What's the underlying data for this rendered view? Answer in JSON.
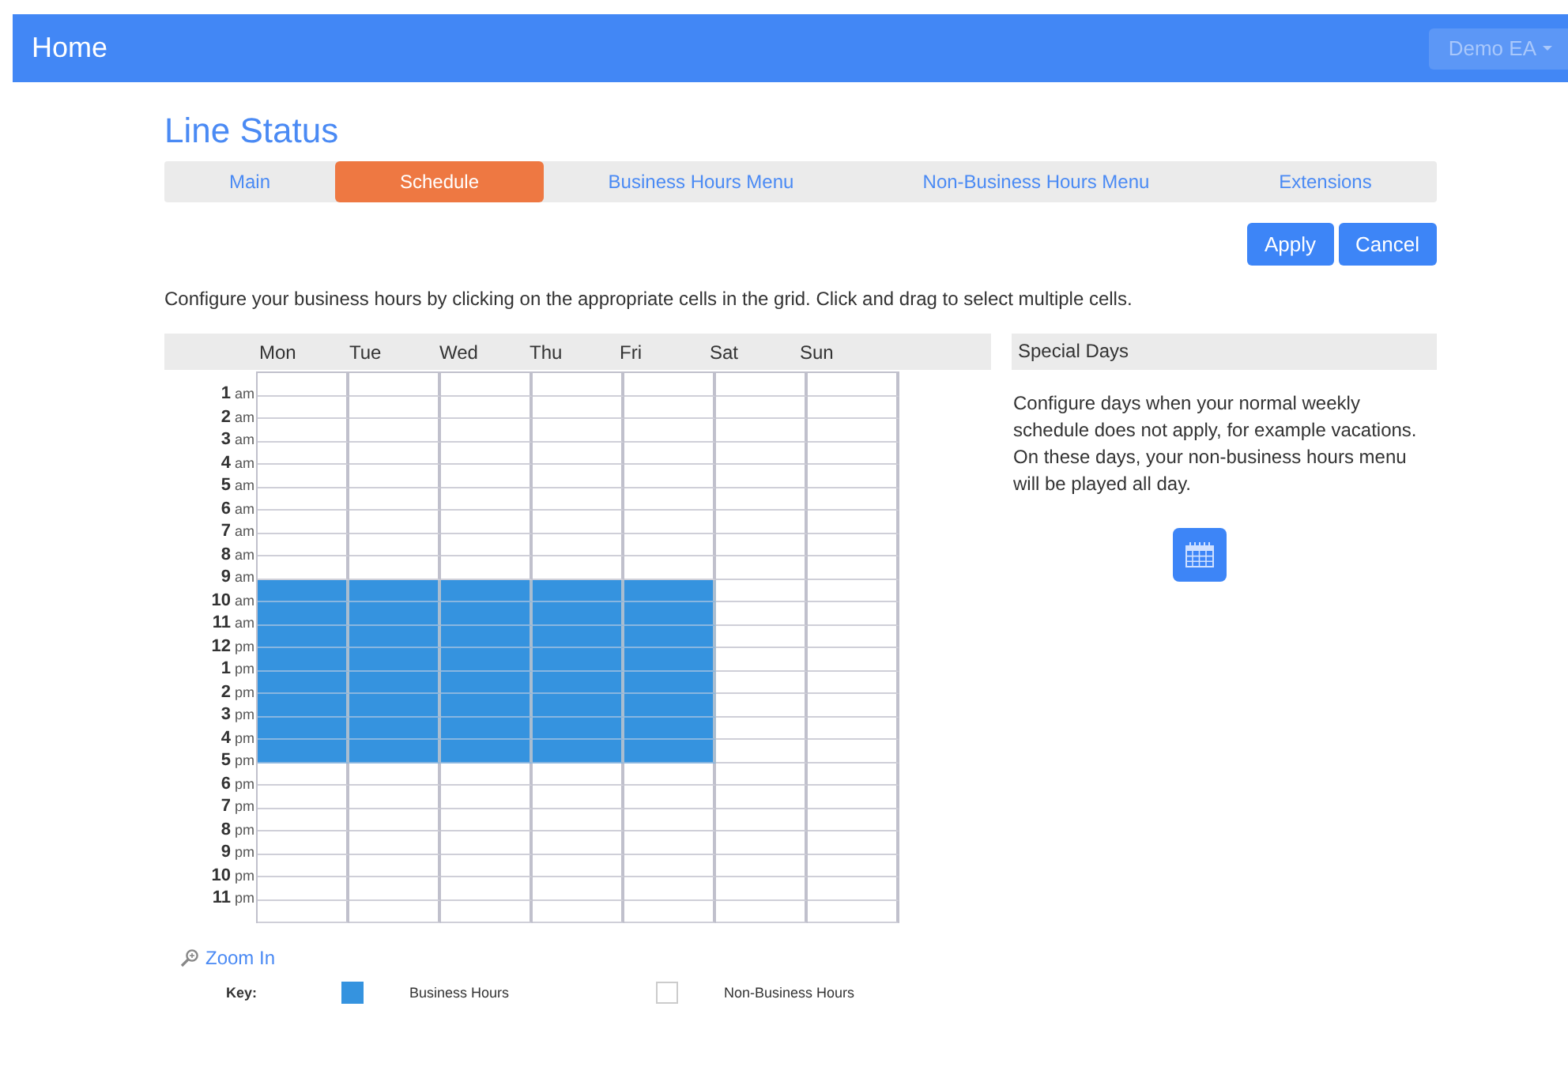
{
  "navbar": {
    "title": "Home",
    "user_menu": "Demo EA"
  },
  "page_title": "Line Status",
  "tabs": [
    {
      "label": "Main",
      "selected": false
    },
    {
      "label": "Schedule",
      "selected": true
    },
    {
      "label": "Business Hours Menu",
      "selected": false
    },
    {
      "label": "Non-Business Hours Menu",
      "selected": false
    },
    {
      "label": "Extensions",
      "selected": false
    }
  ],
  "buttons": [
    "Apply",
    "Cancel"
  ],
  "instructions": "Configure your business hours by clicking on the appropriate cells in the grid. Click and drag to select multiple cells.",
  "schedule": {
    "days": [
      "Mon",
      "Tue",
      "Wed",
      "Thu",
      "Fri",
      "Sat",
      "Sun"
    ],
    "rows": [
      {
        "business": [
          false,
          false,
          false,
          false,
          false,
          false,
          false
        ]
      },
      {
        "hour": "1",
        "period": "am",
        "business": [
          false,
          false,
          false,
          false,
          false,
          false,
          false
        ]
      },
      {
        "hour": "2",
        "period": "am",
        "business": [
          false,
          false,
          false,
          false,
          false,
          false,
          false
        ]
      },
      {
        "hour": "3",
        "period": "am",
        "business": [
          false,
          false,
          false,
          false,
          false,
          false,
          false
        ]
      },
      {
        "hour": "4",
        "period": "am",
        "business": [
          false,
          false,
          false,
          false,
          false,
          false,
          false
        ]
      },
      {
        "hour": "5",
        "period": "am",
        "business": [
          false,
          false,
          false,
          false,
          false,
          false,
          false
        ]
      },
      {
        "hour": "6",
        "period": "am",
        "business": [
          false,
          false,
          false,
          false,
          false,
          false,
          false
        ]
      },
      {
        "hour": "7",
        "period": "am",
        "business": [
          false,
          false,
          false,
          false,
          false,
          false,
          false
        ]
      },
      {
        "hour": "8",
        "period": "am",
        "business": [
          false,
          false,
          false,
          false,
          false,
          false,
          false
        ]
      },
      {
        "hour": "9",
        "period": "am",
        "business": [
          true,
          true,
          true,
          true,
          true,
          false,
          false
        ]
      },
      {
        "hour": "10",
        "period": "am",
        "business": [
          true,
          true,
          true,
          true,
          true,
          false,
          false
        ]
      },
      {
        "hour": "11",
        "period": "am",
        "business": [
          true,
          true,
          true,
          true,
          true,
          false,
          false
        ]
      },
      {
        "hour": "12",
        "period": "pm",
        "business": [
          true,
          true,
          true,
          true,
          true,
          false,
          false
        ]
      },
      {
        "hour": "1",
        "period": "pm",
        "business": [
          true,
          true,
          true,
          true,
          true,
          false,
          false
        ]
      },
      {
        "hour": "2",
        "period": "pm",
        "business": [
          true,
          true,
          true,
          true,
          true,
          false,
          false
        ]
      },
      {
        "hour": "3",
        "period": "pm",
        "business": [
          true,
          true,
          true,
          true,
          true,
          false,
          false
        ]
      },
      {
        "hour": "4",
        "period": "pm",
        "business": [
          true,
          true,
          true,
          true,
          true,
          false,
          false
        ]
      },
      {
        "hour": "5",
        "period": "pm",
        "business": [
          false,
          false,
          false,
          false,
          false,
          false,
          false
        ]
      },
      {
        "hour": "6",
        "period": "pm",
        "business": [
          false,
          false,
          false,
          false,
          false,
          false,
          false
        ]
      },
      {
        "hour": "7",
        "period": "pm",
        "business": [
          false,
          false,
          false,
          false,
          false,
          false,
          false
        ]
      },
      {
        "hour": "8",
        "period": "pm",
        "business": [
          false,
          false,
          false,
          false,
          false,
          false,
          false
        ]
      },
      {
        "hour": "9",
        "period": "pm",
        "business": [
          false,
          false,
          false,
          false,
          false,
          false,
          false
        ]
      },
      {
        "hour": "10",
        "period": "pm",
        "business": [
          false,
          false,
          false,
          false,
          false,
          false,
          false
        ]
      },
      {
        "hour": "11",
        "period": "pm",
        "business": [
          false,
          false,
          false,
          false,
          false,
          false,
          false
        ]
      }
    ]
  },
  "zoom_link": "Zoom In",
  "key": {
    "label": "Key:",
    "items": [
      {
        "label": "Business Hours",
        "business": true
      },
      {
        "label": "Non-Business Hours",
        "business": false
      }
    ]
  },
  "special_days": {
    "title": "Special Days",
    "text": "Configure days when your normal weekly schedule does not apply, for example vacations. On these days, your non-business hours menu will be played all day."
  }
}
